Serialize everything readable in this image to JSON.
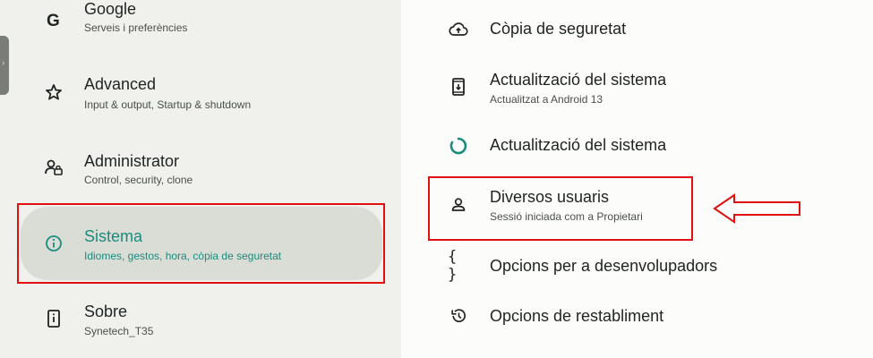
{
  "left_menu": [
    {
      "title": "Google",
      "subtitle": "Serveis i preferències",
      "icon": "google-g-icon"
    },
    {
      "title": "Advanced",
      "subtitle": "Input & output, Startup & shutdown",
      "icon": "star-outline-icon"
    },
    {
      "title": "Administrator",
      "subtitle": "Control, security, clone",
      "icon": "admin-lock-icon"
    },
    {
      "title": "Sistema",
      "subtitle": "Idiomes, gestos, hora, còpia de seguretat",
      "icon": "info-icon"
    },
    {
      "title": "Sobre",
      "subtitle": "Synetech_T35",
      "icon": "tablet-info-icon"
    }
  ],
  "right_menu": [
    {
      "title": "Còpia de seguretat",
      "subtitle": "",
      "icon": "cloud-upload-icon"
    },
    {
      "title": "Actualització del sistema",
      "subtitle": "Actualitzat a Android 13",
      "icon": "system-update-icon"
    },
    {
      "title": "Actualització del sistema",
      "subtitle": "",
      "icon": "update-ring-icon"
    },
    {
      "title": "Diversos usuaris",
      "subtitle": "Sessió iniciada com a Propietari",
      "icon": "person-icon"
    },
    {
      "title": "Opcions per a desenvolupadors",
      "subtitle": "",
      "icon": "braces-icon"
    },
    {
      "title": "Opcions de restabliment",
      "subtitle": "",
      "icon": "history-icon"
    }
  ],
  "colors": {
    "accent_teal": "#1b8b7e",
    "highlight_red": "#e01010",
    "selected_pill": "#d9ddd6"
  },
  "selected_left_item": "Sistema"
}
